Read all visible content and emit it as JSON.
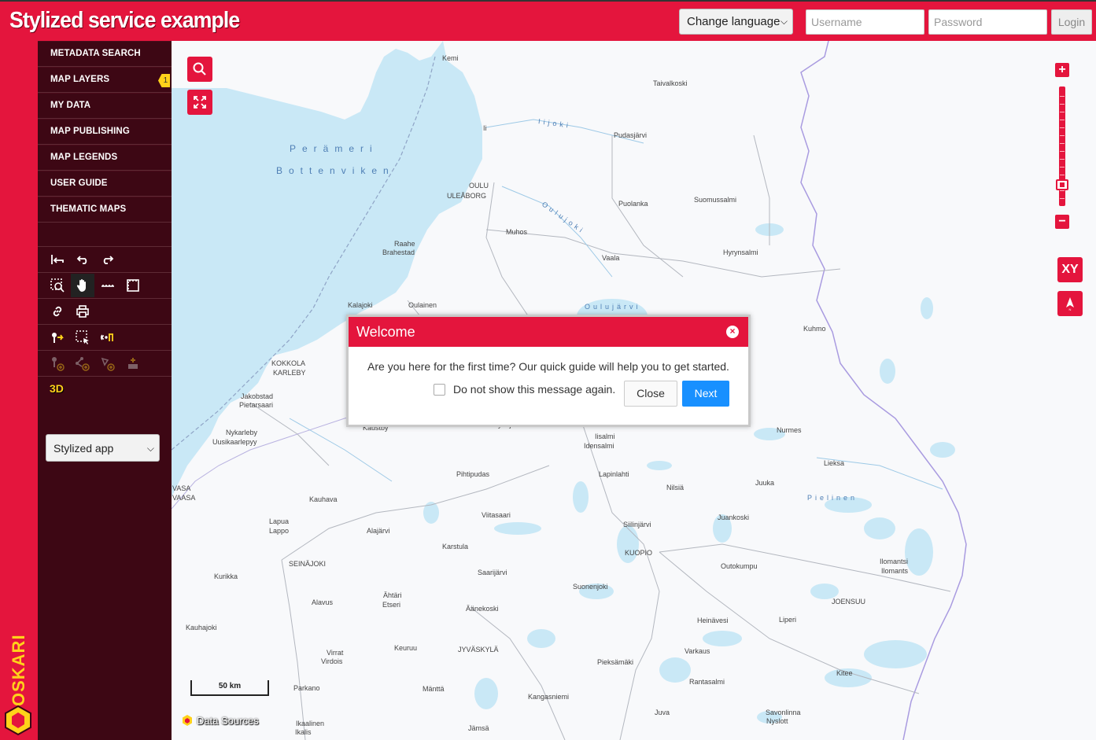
{
  "header": {
    "title": "Stylized service example",
    "language_select": "Change language",
    "username_placeholder": "Username",
    "password_placeholder": "Password",
    "login_label": "Login",
    "brand_color": "#e4153d"
  },
  "sidebar": {
    "menu": [
      {
        "label": "METADATA SEARCH"
      },
      {
        "label": "MAP LAYERS",
        "badge": "1"
      },
      {
        "label": "MY DATA"
      },
      {
        "label": "MAP PUBLISHING"
      },
      {
        "label": "MAP LEGENDS"
      },
      {
        "label": "USER GUIDE"
      },
      {
        "label": "THEMATIC MAPS"
      }
    ],
    "tools": {
      "row1": [
        "reset-view-icon",
        "undo-icon",
        "redo-icon"
      ],
      "row2": [
        "zoom-box-icon",
        "pan-hand-icon",
        "measure-line-icon",
        "measure-area-icon"
      ],
      "row3": [
        "link-icon",
        "print-icon"
      ],
      "row4": [
        "get-info-icon",
        "select-feature-icon",
        "gfi-icon"
      ],
      "row5": [
        "add-point-icon",
        "add-line-icon",
        "add-area-icon",
        "add-layer-icon"
      ]
    },
    "btn_3d": "3D",
    "app_select": "Stylized app",
    "logo_text": "OSKARI"
  },
  "map": {
    "scale_label": "50 km",
    "data_sources": "Data Sources",
    "xy_label": "XY",
    "places": [
      {
        "name": "Kemi"
      },
      {
        "name": "Taivalkoski"
      },
      {
        "name": "Pudasjärvi"
      },
      {
        "name": "Ii"
      },
      {
        "name": "OULU"
      },
      {
        "name": "ULEÅBORG"
      },
      {
        "name": "Puolanka"
      },
      {
        "name": "Suomussalmi"
      },
      {
        "name": "Muhos"
      },
      {
        "name": "Raahe"
      },
      {
        "name": "Brahestad"
      },
      {
        "name": "Vaala"
      },
      {
        "name": "Hyrynsalmi"
      },
      {
        "name": "Kalajoki"
      },
      {
        "name": "Oulainen"
      },
      {
        "name": "Kuhmo"
      },
      {
        "name": "KOKKOLA"
      },
      {
        "name": "KARLEBY"
      },
      {
        "name": "Jakobstad"
      },
      {
        "name": "Pietarsaari"
      },
      {
        "name": "Kaustby"
      },
      {
        "name": "Pyhäjärvi"
      },
      {
        "name": "Iisalmi"
      },
      {
        "name": "Idensalmi"
      },
      {
        "name": "Nurmes"
      },
      {
        "name": "Nykarleby"
      },
      {
        "name": "Uusikaarlepyy"
      },
      {
        "name": "Pihtipudas"
      },
      {
        "name": "Lapinlahti"
      },
      {
        "name": "Lieksa"
      },
      {
        "name": "Nilsiä"
      },
      {
        "name": "Juuka"
      },
      {
        "name": "Kauhava"
      },
      {
        "name": "Viitasaari"
      },
      {
        "name": "Juankoski"
      },
      {
        "name": "Lapua"
      },
      {
        "name": "Lappo"
      },
      {
        "name": "Alajärvi"
      },
      {
        "name": "Siilinjärvi"
      },
      {
        "name": "Karstula"
      },
      {
        "name": "KUOPIO"
      },
      {
        "name": "SEINÄJOKI"
      },
      {
        "name": "Outokumpu"
      },
      {
        "name": "Saarijärvi"
      },
      {
        "name": "Ilomantsi"
      },
      {
        "name": "Ilomants"
      },
      {
        "name": "Kurikka"
      },
      {
        "name": "Suonenjoki"
      },
      {
        "name": "Ähtäri"
      },
      {
        "name": "Etseri"
      },
      {
        "name": "Alavus"
      },
      {
        "name": "Äänekoski"
      },
      {
        "name": "JOENSUU"
      },
      {
        "name": "Kauhajoki"
      },
      {
        "name": "Heinävesi"
      },
      {
        "name": "Liperi"
      },
      {
        "name": "Virrat"
      },
      {
        "name": "Virdois"
      },
      {
        "name": "Keuruu"
      },
      {
        "name": "JYVÄSKYLÄ"
      },
      {
        "name": "Varkaus"
      },
      {
        "name": "Pieksämäki"
      },
      {
        "name": "Kitee"
      },
      {
        "name": "Rantasalmi"
      },
      {
        "name": "Parkano"
      },
      {
        "name": "Mänttä"
      },
      {
        "name": "Kangasniemi"
      },
      {
        "name": "Juva"
      },
      {
        "name": "Savonlinna"
      },
      {
        "name": "Nyslott"
      },
      {
        "name": "Ikaalinen"
      },
      {
        "name": "Ikalis"
      },
      {
        "name": "Jämsä"
      },
      {
        "name": "VASA"
      },
      {
        "name": "VAASA"
      }
    ],
    "water_labels": [
      "Perämeri",
      "Bottenviken",
      "Iijoki",
      "Oulujoki",
      "Oulujärvi",
      "Pielinen"
    ]
  },
  "dialog": {
    "title": "Welcome",
    "message": "Are you here for the first time? Our quick guide will help you to get started.",
    "checkbox_label": "Do not show this message again.",
    "close_label": "Close",
    "next_label": "Next",
    "next_color": "#1890ff"
  }
}
